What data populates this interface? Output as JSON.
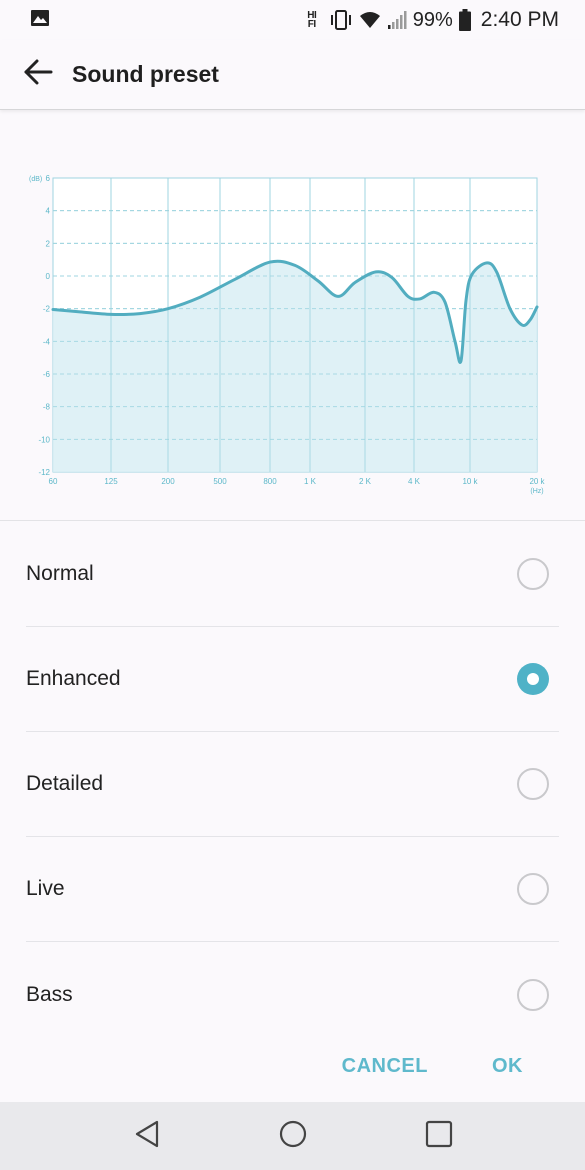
{
  "status_bar": {
    "hifi_top": "HI",
    "hifi_bottom": "FI",
    "battery_pct": "99%",
    "time": "2:40 PM"
  },
  "app_bar": {
    "title": "Sound preset",
    "back_icon": "arrow-back-icon"
  },
  "chart_data": {
    "type": "area",
    "ylabel": "(dB)",
    "xlabel": "(Hz)",
    "ylim": [
      -12,
      6
    ],
    "yticks": [
      "6",
      "4",
      "2",
      "0",
      "-2",
      "-4",
      "-6",
      "-8",
      "-10",
      "-12"
    ],
    "xticks": [
      "60",
      "125",
      "200",
      "500",
      "800",
      "1 K",
      "2 K",
      "4 K",
      "10 k",
      "20 k"
    ],
    "grid": true,
    "x": [
      60,
      90,
      125,
      160,
      200,
      300,
      500,
      800,
      1000,
      1300,
      1600,
      2000,
      2400,
      3000,
      3600,
      4200,
      5000,
      6000,
      7000,
      8000,
      8800,
      9700,
      10600,
      12000,
      13500,
      15000,
      17000,
      18500,
      20000
    ],
    "y": [
      -2.1,
      -2.25,
      -2.35,
      -2.25,
      -2.0,
      -1.2,
      -0.2,
      0.85,
      0.7,
      -0.2,
      -1.2,
      -0.4,
      0.2,
      0.1,
      -0.6,
      -1.2,
      -1.4,
      -1.3,
      -1.0,
      -1.3,
      -2.0,
      -3.8,
      -5.2,
      -4.2,
      0.0,
      0.6,
      0.85,
      0.5,
      -1.0,
      -2.6,
      -3.0,
      -1.8
    ]
  },
  "options": [
    {
      "label": "Normal",
      "checked": false
    },
    {
      "label": "Enhanced",
      "checked": true
    },
    {
      "label": "Detailed",
      "checked": false
    },
    {
      "label": "Live",
      "checked": false
    },
    {
      "label": "Bass",
      "checked": false
    }
  ],
  "actions": {
    "cancel": "CANCEL",
    "ok": "OK"
  },
  "nav_bar": {
    "back_icon": "nav-back-icon",
    "home_icon": "nav-home-icon",
    "recents_icon": "nav-recents-icon"
  },
  "colors": {
    "accent": "#4fb2c7",
    "curve": "#52adc0",
    "fill": "#d9eff5",
    "grid": "#9fd4e0"
  }
}
